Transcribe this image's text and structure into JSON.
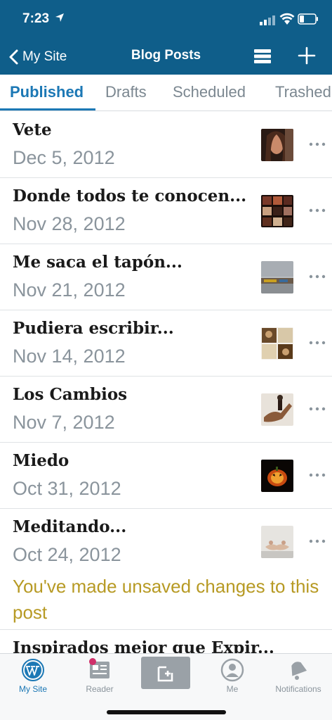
{
  "status_bar": {
    "time": "7:23"
  },
  "nav": {
    "back_label": "My Site",
    "title": "Blog Posts"
  },
  "tabs": [
    {
      "label": "Published",
      "active": true
    },
    {
      "label": "Drafts",
      "active": false
    },
    {
      "label": "Scheduled",
      "active": false
    },
    {
      "label": "Trashed",
      "active": false
    }
  ],
  "posts": [
    {
      "title": "Vete",
      "date": "Dec 5, 2012",
      "thumb": "portrait-photo"
    },
    {
      "title": "Donde todos te conocen...",
      "date": "Nov 28, 2012",
      "thumb": "collage-photo"
    },
    {
      "title": "Me saca el tapón...",
      "date": "Nov 21, 2012",
      "thumb": "landscape-photo"
    },
    {
      "title": "Pudiera escribir...",
      "date": "Nov 14, 2012",
      "thumb": "collage-photo"
    },
    {
      "title": "Los Cambios",
      "date": "Nov 7, 2012",
      "thumb": "hands-photo"
    },
    {
      "title": "Miedo",
      "date": "Oct 31, 2012",
      "thumb": "pumpkin-photo"
    },
    {
      "title": "Meditando...",
      "date": "Oct 24, 2012",
      "thumb": "meditation-photo",
      "note": "You've made unsaved changes to this post"
    },
    {
      "title": "Inspirados mejor que Expir..."
    }
  ],
  "tabbar": {
    "items": [
      {
        "label": "My Site",
        "active": true
      },
      {
        "label": "Reader",
        "active": false
      },
      {
        "label": "Me",
        "active": false
      },
      {
        "label": "Notifications",
        "active": false
      }
    ]
  },
  "colors": {
    "header_bg": "#0f5e8a",
    "accent": "#1c78b5",
    "unsaved_note": "#b79a24"
  }
}
